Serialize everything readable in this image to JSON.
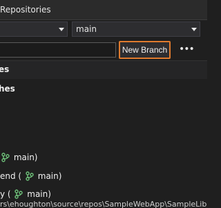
{
  "window": {
    "title": "Repositories"
  },
  "toolbar": {
    "repo_combo_value": "",
    "branch_combo_value": "main",
    "new_branch_label": "New Branch",
    "more_label": "•••"
  },
  "tree": {
    "section1_label": "es",
    "section2_label": "hes",
    "rows": [
      {
        "prefix": "",
        "suffix": "main)"
      },
      {
        "prefix": "end  (",
        "suffix": "main)"
      },
      {
        "prefix": "y  (",
        "suffix": "main)"
      }
    ]
  },
  "status": {
    "path_text": "rs\\ehoughton\\source\\repos\\SampleWebApp\\SampleLibrar"
  },
  "colors": {
    "accent_highlight": "#e07b2e",
    "branch_icon": "#6fc27a"
  },
  "icons": [
    "chevron-down-icon",
    "more-icon",
    "branch-icon"
  ]
}
